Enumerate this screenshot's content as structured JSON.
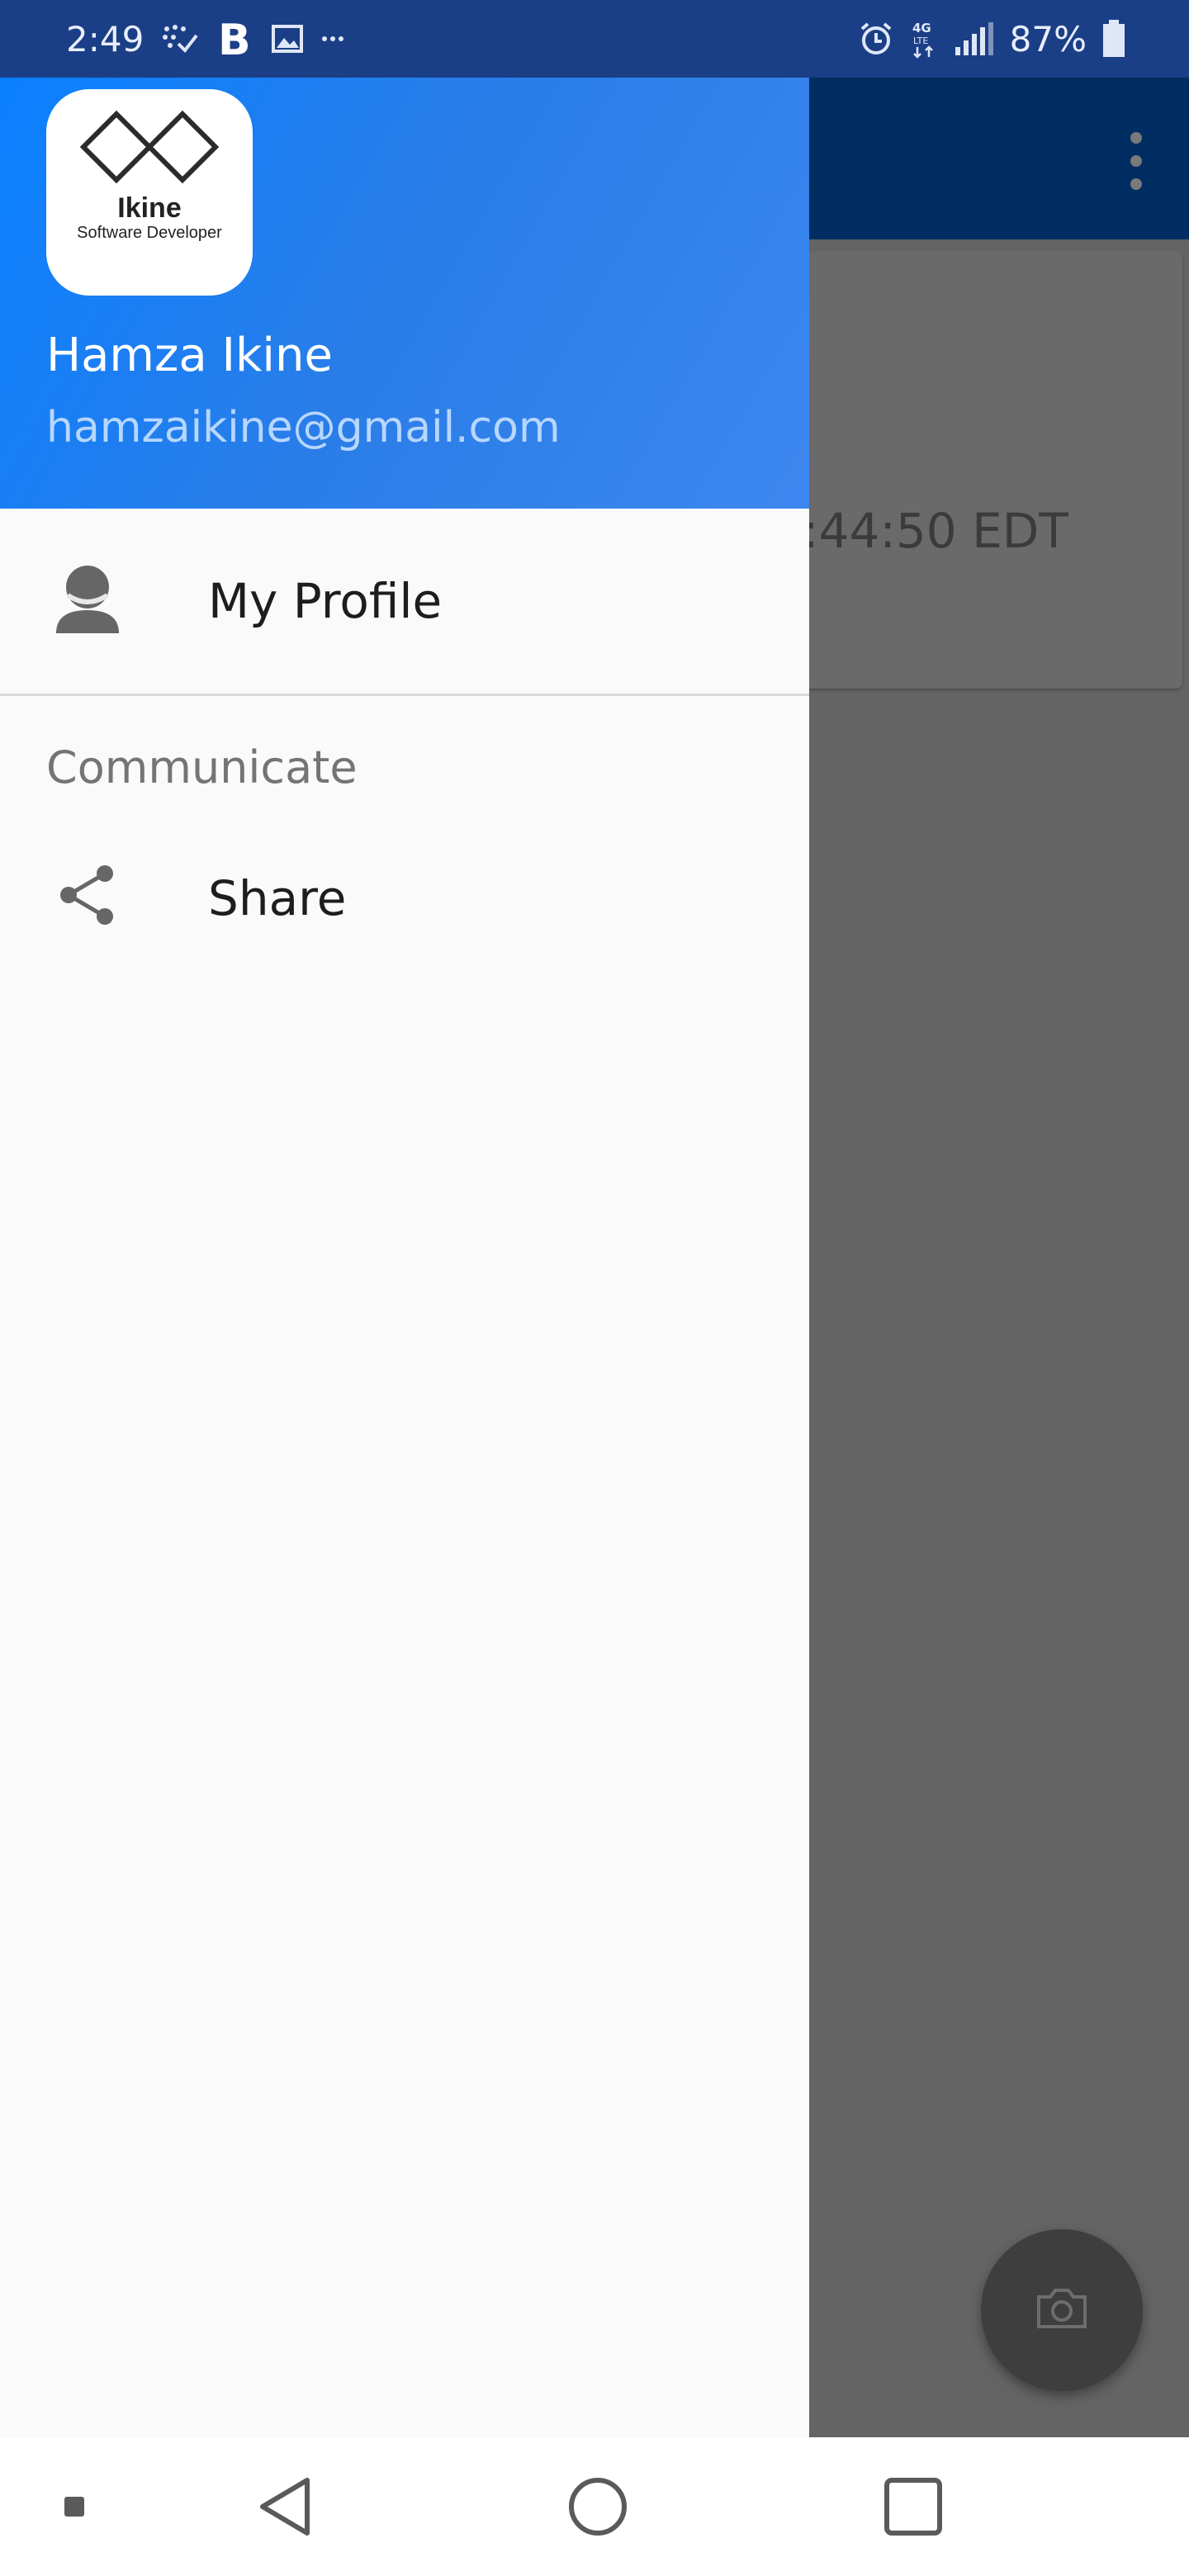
{
  "status_bar": {
    "time": "2:49",
    "battery_percent": "87%",
    "left_icons": [
      "sparkle-check-icon",
      "bold-b-icon",
      "image-icon",
      "more-dots-icon"
    ],
    "right_icons": [
      "alarm-icon",
      "4g-lte-icon",
      "signal-icon",
      "battery-icon"
    ]
  },
  "drawer": {
    "logo": {
      "word": "Ikine",
      "subtitle": "Software Developer"
    },
    "user_name": "Hamza Ikine",
    "user_email": "hamzaikine@gmail.com",
    "items": [
      {
        "label": "My Profile",
        "icon": "person-icon"
      }
    ],
    "section_title": "Communicate",
    "section_items": [
      {
        "label": "Share",
        "icon": "share-icon"
      }
    ]
  },
  "background_app": {
    "card_text": ":44:50 EDT",
    "fab_icon": "camera-icon"
  },
  "colors": {
    "header_gradient_start": "#0a80ff",
    "header_gradient_end": "#3d87ef",
    "toolbar": "#002d62",
    "status_bar": "#1b3f86",
    "scrim": "#646464"
  }
}
